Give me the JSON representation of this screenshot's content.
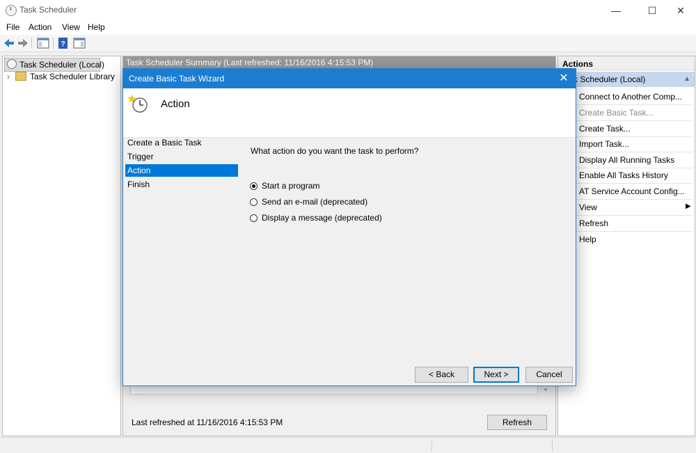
{
  "window": {
    "title": "Task Scheduler",
    "controls": {
      "minimize": "—",
      "maximize": "☐",
      "close": "✕"
    }
  },
  "menu": [
    "File",
    "Action",
    "View",
    "Help"
  ],
  "toolbar": {
    "icons": [
      "back-arrow-icon",
      "forward-arrow-icon",
      "show-hide-console-tree-icon",
      "help-icon",
      "show-hide-action-pane-icon"
    ]
  },
  "tree": {
    "items": [
      {
        "label": "Task Scheduler (Local)",
        "icon": "clock-icon",
        "selected": true
      },
      {
        "label": "Task Scheduler Library",
        "icon": "folder-clock-icon",
        "expander": "›"
      }
    ]
  },
  "center": {
    "summary_header": "Task Scheduler Summary (Last refreshed: 11/16/2016 4:15:53 PM)",
    "last_refreshed": "Last refreshed at 11/16/2016 4:15:53 PM",
    "refresh_label": "Refresh"
  },
  "actions": {
    "header": "Actions",
    "group": "k Scheduler (Local)",
    "items": [
      {
        "label": "Connect to Another Comp...",
        "enabled": true
      },
      {
        "label": "Create Basic Task...",
        "enabled": false
      },
      {
        "label": "Create Task...",
        "enabled": true
      },
      {
        "label": "Import Task...",
        "enabled": true
      },
      {
        "label": "Display All Running Tasks",
        "enabled": true
      },
      {
        "label": "Enable All Tasks History",
        "enabled": true
      },
      {
        "label": "AT Service Account Config...",
        "enabled": true
      },
      {
        "label": "View",
        "enabled": true,
        "submenu": true
      },
      {
        "label": "Refresh",
        "enabled": true
      },
      {
        "label": "Help",
        "enabled": true
      }
    ]
  },
  "dialog": {
    "title": "Create Basic Task Wizard",
    "close_glyph": "✕",
    "header_title": "Action",
    "steps": [
      {
        "label": "Create a Basic Task",
        "active": false
      },
      {
        "label": "Trigger",
        "active": false
      },
      {
        "label": "Action",
        "active": true
      },
      {
        "label": "Finish",
        "active": false
      }
    ],
    "question": "What action do you want the task to perform?",
    "options": [
      {
        "label": "Start a program",
        "selected": true
      },
      {
        "label": "Send an e-mail (deprecated)",
        "selected": false
      },
      {
        "label": "Display a message (deprecated)",
        "selected": false
      }
    ],
    "buttons": {
      "back": "< Back",
      "next": "Next >",
      "cancel": "Cancel"
    }
  },
  "colors": {
    "accent": "#0078d7",
    "dialog_titlebar": "#1c7dd0",
    "summary_header": "#9a9a9a",
    "actions_group": "#c6d8ee"
  }
}
